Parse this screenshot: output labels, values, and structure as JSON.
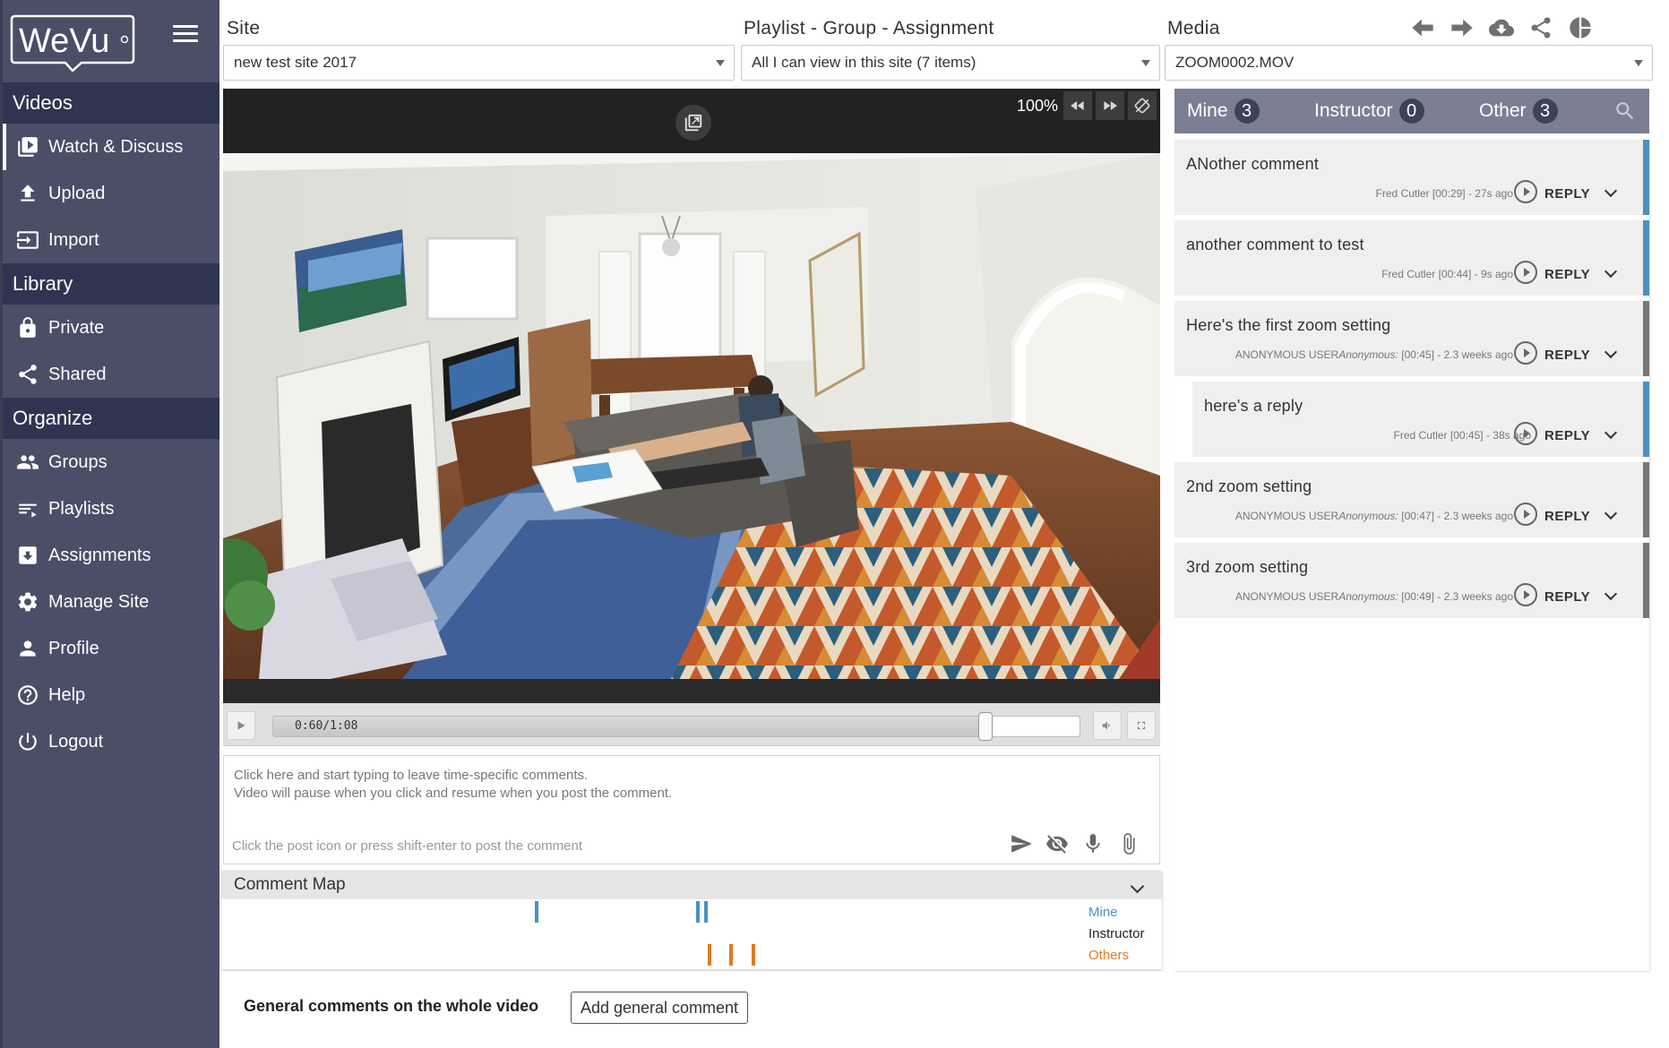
{
  "app": {
    "logo_text": "WeVu"
  },
  "sidebar": {
    "sections": [
      {
        "title": "Videos",
        "items": [
          {
            "label": "Watch & Discuss",
            "icon": "video-library-icon",
            "active": true
          },
          {
            "label": "Upload",
            "icon": "upload-icon"
          },
          {
            "label": "Import",
            "icon": "import-icon"
          }
        ]
      },
      {
        "title": "Library",
        "items": [
          {
            "label": "Private",
            "icon": "lock-icon"
          },
          {
            "label": "Shared",
            "icon": "share-icon"
          }
        ]
      },
      {
        "title": "Organize",
        "items": [
          {
            "label": "Groups",
            "icon": "groups-icon"
          },
          {
            "label": "Playlists",
            "icon": "playlist-icon"
          },
          {
            "label": "Assignments",
            "icon": "assignment-icon"
          },
          {
            "label": "Manage Site",
            "icon": "gear-icon"
          },
          {
            "label": "Profile",
            "icon": "person-icon"
          },
          {
            "label": "Help",
            "icon": "help-icon"
          },
          {
            "label": "Logout",
            "icon": "power-icon"
          }
        ]
      }
    ]
  },
  "header": {
    "site": {
      "label": "Site",
      "value": "new test site 2017"
    },
    "playlist": {
      "label": "Playlist - Group - Assignment",
      "value": "All I can view in this site (7 items)"
    },
    "media": {
      "label": "Media",
      "value": "ZOOM0002.MOV"
    },
    "icons": [
      "arrow-left-icon",
      "arrow-right-icon",
      "cloud-download-icon",
      "share-icon",
      "pie-chart-icon"
    ]
  },
  "player": {
    "zoom": "100%",
    "time": "0:60/1:08",
    "progress": 0.883
  },
  "comment_entry": {
    "placeholder_line1": "Click here and start typing to leave time-specific comments.",
    "placeholder_line2": "Video will pause when you click and resume when you post the comment.",
    "hint": "Click the post icon or press shift-enter to post the comment"
  },
  "comment_map": {
    "title": "Comment Map",
    "legend": {
      "mine": "Mine",
      "instructor": "Instructor",
      "others": "Others"
    },
    "colors": {
      "mine": "#4a90c4",
      "instructor": "#222222",
      "others": "#e07a22"
    }
  },
  "general": {
    "label": "General comments on the whole video",
    "button": "Add general comment"
  },
  "tabs": {
    "mine": {
      "label": "Mine",
      "count": "3"
    },
    "instructor": {
      "label": "Instructor",
      "count": "0"
    },
    "other": {
      "label": "Other",
      "count": "3"
    }
  },
  "comments": [
    {
      "text": "ANother comment",
      "author": "Fred Cutler",
      "anon": "",
      "time": "[00:29]",
      "ago": "- 27s ago",
      "reply": "REPLY",
      "color": "#4a90c4"
    },
    {
      "text": "another comment to test",
      "author": "Fred Cutler",
      "anon": "",
      "time": "[00:44]",
      "ago": "- 9s ago",
      "reply": "REPLY",
      "color": "#4a90c4"
    },
    {
      "text": "Here's the first zoom setting",
      "author": "ANONYMOUS USER",
      "anon": "Anonymous:",
      "time": "[00:45]",
      "ago": "- 2.3 weeks ago",
      "reply": "REPLY",
      "color": "#777777"
    },
    {
      "text": "here's  a reply",
      "author": "Fred Cutler",
      "anon": "",
      "time": "[00:45]",
      "ago": "- 38s ago",
      "reply": "REPLY",
      "color": "#4a90c4"
    },
    {
      "text": "2nd zoom setting",
      "author": "ANONYMOUS USER",
      "anon": "Anonymous:",
      "time": "[00:47]",
      "ago": "- 2.3 weeks ago",
      "reply": "REPLY",
      "color": "#777777"
    },
    {
      "text": "3rd zoom setting",
      "author": "ANONYMOUS USER",
      "anon": "Anonymous:",
      "time": "[00:49]",
      "ago": "- 2.3 weeks ago",
      "reply": "REPLY",
      "color": "#777777"
    }
  ]
}
